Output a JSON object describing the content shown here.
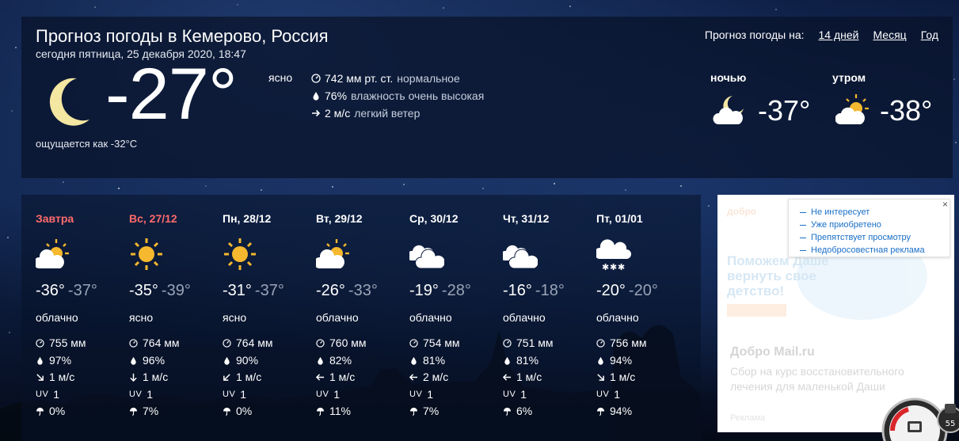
{
  "header": {
    "title": "Прогноз погоды в Кемерово, Россия",
    "date_line": "сегодня пятница, 25 декабря 2020, 18:47",
    "nav_label": "Прогноз погоды на:",
    "nav_links": [
      "14 дней",
      "Месяц",
      "Год"
    ]
  },
  "current": {
    "icon": "moon-icon",
    "temperature": "-27°",
    "condition": "ясно",
    "feels_like": "ощущается как -32°C",
    "pressure_value": "742 мм рт. ст.",
    "pressure_note": "нормальное",
    "humidity_value": "76%",
    "humidity_note": "влажность очень высокая",
    "wind_value": "2 м/с",
    "wind_note": "легкий ветер"
  },
  "day_parts": [
    {
      "label": "ночью",
      "temperature": "-37°",
      "icon": "moon-cloud-icon"
    },
    {
      "label": "утром",
      "temperature": "-38°",
      "icon": "sun-cloud-icon"
    }
  ],
  "days": [
    {
      "name": "Завтра",
      "weekend": true,
      "icon": "sun-cloud-icon",
      "tmax": "-36°",
      "tmin": "-37°",
      "condition": "облачно",
      "pressure": "755 мм",
      "humidity": "97%",
      "wind_dir": "se",
      "wind": "1 м/с",
      "uv_label": "UV",
      "uv": "1",
      "precip": "0%"
    },
    {
      "name": "Вс, 27/12",
      "weekend": true,
      "icon": "sun-icon",
      "tmax": "-35°",
      "tmin": "-39°",
      "condition": "ясно",
      "pressure": "764 мм",
      "humidity": "96%",
      "wind_dir": "s",
      "wind": "1 м/с",
      "uv_label": "UV",
      "uv": "1",
      "precip": "7%"
    },
    {
      "name": "Пн, 28/12",
      "weekend": false,
      "icon": "sun-icon",
      "tmax": "-31°",
      "tmin": "-37°",
      "condition": "ясно",
      "pressure": "764 мм",
      "humidity": "90%",
      "wind_dir": "sw",
      "wind": "1 м/с",
      "uv_label": "UV",
      "uv": "1",
      "precip": "0%"
    },
    {
      "name": "Вт, 29/12",
      "weekend": false,
      "icon": "sun-cloud-icon",
      "tmax": "-26°",
      "tmin": "-33°",
      "condition": "облачно",
      "pressure": "760 мм",
      "humidity": "82%",
      "wind_dir": "w",
      "wind": "1 м/с",
      "uv_label": "UV",
      "uv": "1",
      "precip": "11%"
    },
    {
      "name": "Ср, 30/12",
      "weekend": false,
      "icon": "cloud-icon",
      "tmax": "-19°",
      "tmin": "-28°",
      "condition": "облачно",
      "pressure": "754 мм",
      "humidity": "81%",
      "wind_dir": "w",
      "wind": "2 м/с",
      "uv_label": "UV",
      "uv": "1",
      "precip": "7%"
    },
    {
      "name": "Чт, 31/12",
      "weekend": false,
      "icon": "cloud-icon",
      "tmax": "-16°",
      "tmin": "-18°",
      "condition": "облачно",
      "pressure": "751 мм",
      "humidity": "81%",
      "wind_dir": "w",
      "wind": "1 м/с",
      "uv_label": "UV",
      "uv": "1",
      "precip": "6%"
    },
    {
      "name": "Пт, 01/01",
      "weekend": false,
      "icon": "snow-cloud-icon",
      "tmax": "-20°",
      "tmin": "-20°",
      "condition": "облачно",
      "pressure": "756 мм",
      "humidity": "94%",
      "wind_dir": "se",
      "wind": "1 м/с",
      "uv_label": "UV",
      "uv": "1",
      "precip": "94%"
    }
  ],
  "ad": {
    "logo": "добро",
    "hero": "Поможем Даше вернуть свое детство!",
    "title": "Добро Mail.ru",
    "description": "Сбор на курс восстановительного лечения для маленькой Даши",
    "footer": "Реклама",
    "close": "×",
    "menu_options": [
      "Не интересует",
      "Уже приобретено",
      "Препятствует просмотру",
      "Недобросовестная реклама"
    ]
  },
  "widget": {
    "counter": "55"
  },
  "colors": {
    "weekend_red": "#ff6b6b",
    "link_blue": "#1a6fc7",
    "sun_yellow": "#f5b82e",
    "moon_yellow": "#f3e7a1"
  }
}
